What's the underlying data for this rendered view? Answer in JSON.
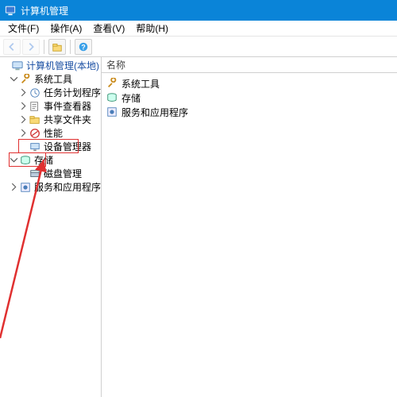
{
  "window": {
    "title": "计算机管理"
  },
  "menu": {
    "file": "文件(F)",
    "action": "操作(A)",
    "view": "查看(V)",
    "help": "帮助(H)"
  },
  "tree": {
    "root": "计算机管理(本地)",
    "system_tools": "系统工具",
    "task_scheduler": "任务计划程序",
    "event_viewer": "事件查看器",
    "shared_folders": "共享文件夹",
    "performance": "性能",
    "device_manager": "设备管理器",
    "storage": "存储",
    "disk_mgmt": "磁盘管理",
    "services_apps": "服务和应用程序"
  },
  "list": {
    "header": "名称",
    "items": [
      "系统工具",
      "存储",
      "服务和应用程序"
    ]
  }
}
